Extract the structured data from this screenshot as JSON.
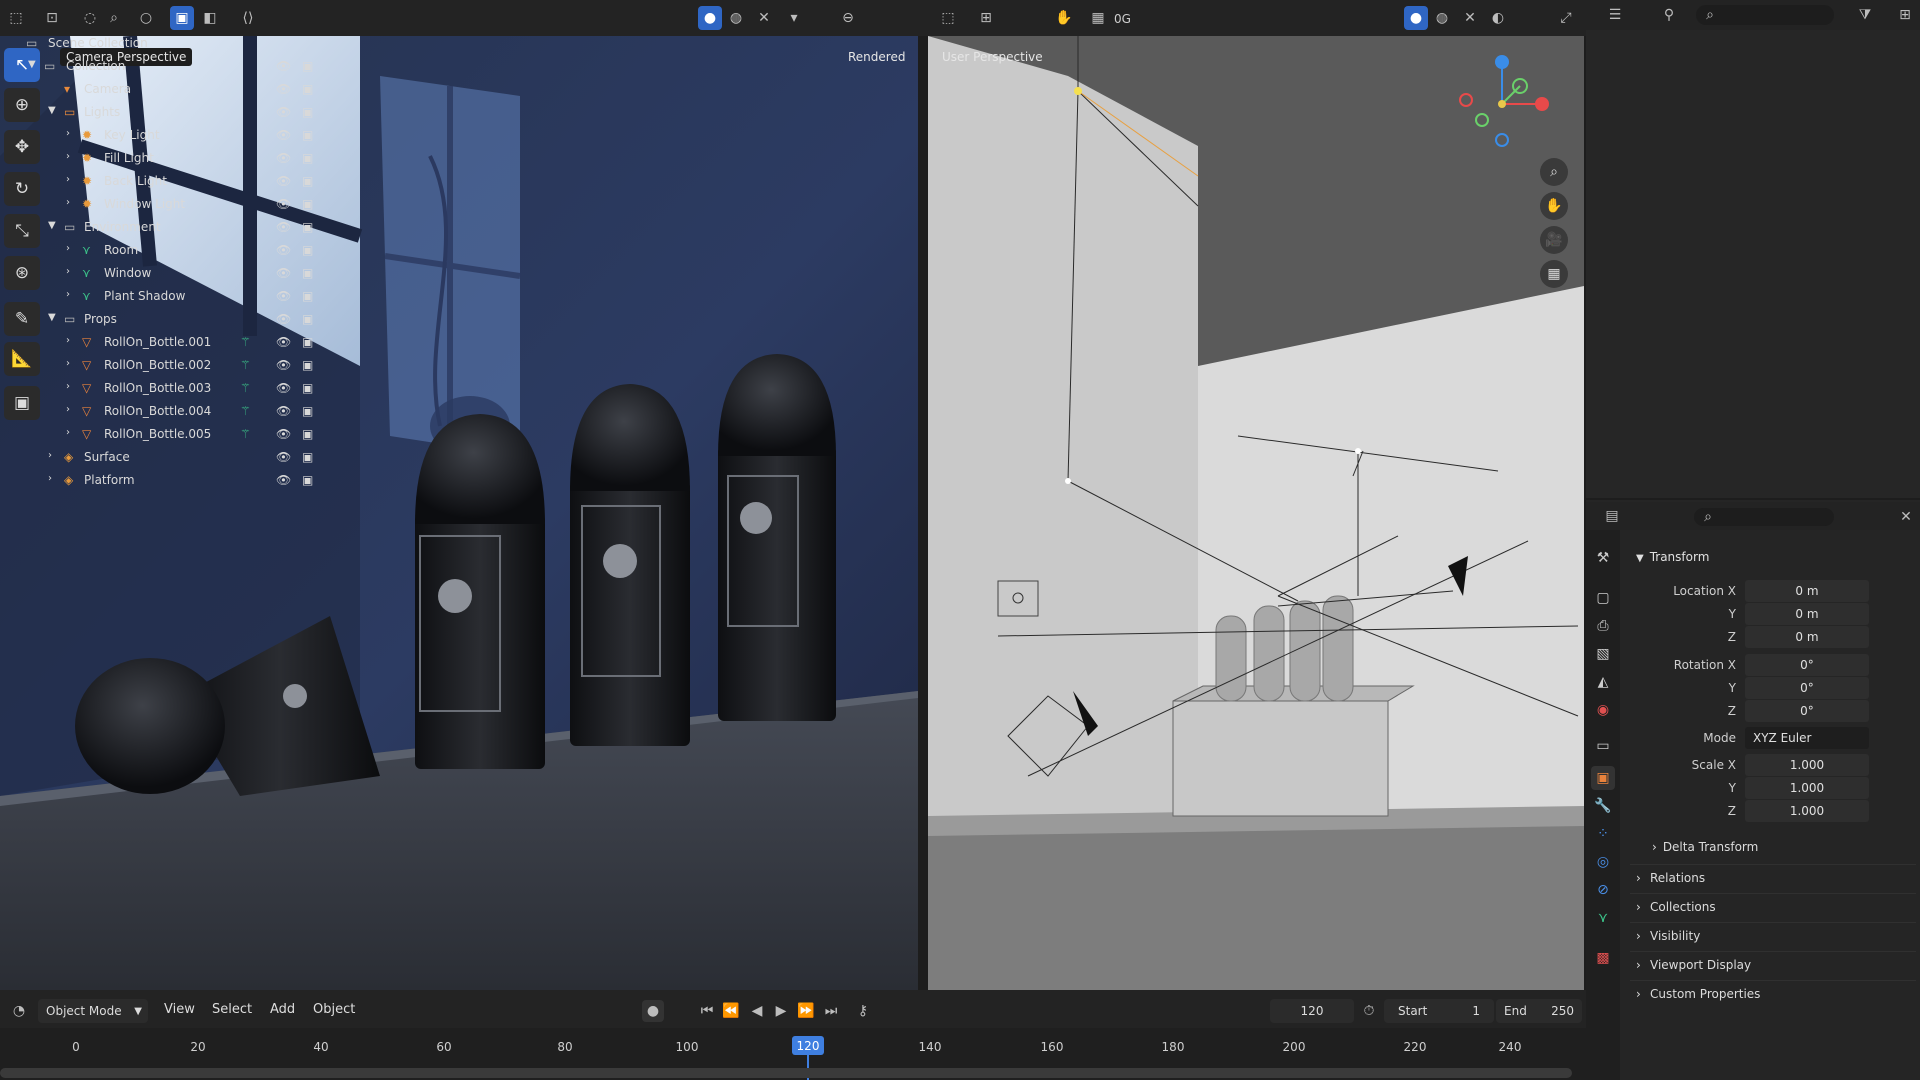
{
  "left_viewport": {
    "label": "Camera Perspective",
    "shading_label": "Rendered"
  },
  "right_viewport": {
    "label": "User Perspective"
  },
  "top_header": {
    "overlay_value": "0G"
  },
  "footer": {
    "mode": "Object Mode",
    "menus": [
      "View",
      "Select",
      "Add",
      "Object"
    ],
    "current_frame": "120",
    "start_label": "Start",
    "start_value": "1",
    "end_label": "End",
    "end_value": "250"
  },
  "timeline": {
    "ticks": [
      "0",
      "20",
      "40",
      "60",
      "80",
      "100",
      "120",
      "140",
      "160",
      "180",
      "200",
      "220",
      "240"
    ],
    "current_frame": "120"
  },
  "outliner": {
    "items": [
      {
        "label": "Scene Collection",
        "icon": "scene-collection-icon"
      },
      {
        "label": "Collection",
        "icon": "collection-icon"
      },
      {
        "label": "Camera",
        "icon": "camera-icon"
      },
      {
        "label": "Lights",
        "icon": "collection-icon"
      },
      {
        "label": "Key Light",
        "icon": "light-icon"
      },
      {
        "label": "Fill Light",
        "icon": "light-icon"
      },
      {
        "label": "Back Light",
        "icon": "light-icon"
      },
      {
        "label": "Window Light",
        "icon": "light-icon"
      },
      {
        "label": "Environment",
        "icon": "collection-icon"
      },
      {
        "label": "Room",
        "icon": "mesh-icon"
      },
      {
        "label": "Window",
        "icon": "mesh-icon"
      },
      {
        "label": "Plant Shadow",
        "icon": "mesh-icon"
      },
      {
        "label": "Props",
        "icon": "collection-icon"
      },
      {
        "label": "RollOn_Bottle.001",
        "icon": "mesh-icon"
      },
      {
        "label": "RollOn_Bottle.002",
        "icon": "mesh-icon"
      },
      {
        "label": "RollOn_Bottle.003",
        "icon": "mesh-icon"
      },
      {
        "label": "RollOn_Bottle.004",
        "icon": "mesh-icon"
      },
      {
        "label": "RollOn_Bottle.005",
        "icon": "mesh-icon"
      },
      {
        "label": "Surface",
        "icon": "object-icon"
      },
      {
        "label": "Platform",
        "icon": "object-icon"
      }
    ]
  },
  "properties": {
    "transform_title": "Transform",
    "location_x_label": "Location X",
    "location_x": "0 m",
    "location_y_label": "Y",
    "location_y": "0 m",
    "location_z_label": "Z",
    "location_z": "0 m",
    "rotation_x_label": "Rotation X",
    "rotation_x": "0°",
    "rotation_y_label": "Y",
    "rotation_y": "0°",
    "rotation_z_label": "Z",
    "rotation_z": "0°",
    "mode_label": "Mode",
    "mode_value": "XYZ Euler",
    "scale_x_label": "Scale X",
    "scale_x": "1.000",
    "scale_y_label": "Y",
    "scale_y": "1.000",
    "scale_z_label": "Z",
    "scale_z": "1.000",
    "delta_transform": "Delta Transform",
    "sections": [
      "Relations",
      "Collections",
      "Visibility",
      "Viewport Display",
      "Custom Properties"
    ]
  },
  "colors": {
    "accent": "#2f66c4",
    "panel": "#262626",
    "light_orange": "#e89a3c",
    "mesh_orange": "#e8823c",
    "modifier_green": "#3cc48a"
  }
}
